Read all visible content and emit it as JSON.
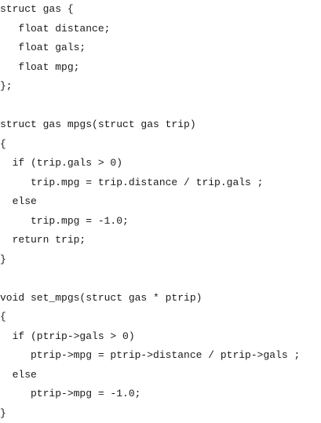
{
  "code_lines": [
    "struct gas {",
    "   float distance;",
    "   float gals;",
    "   float mpg;",
    "};",
    "",
    "struct gas mpgs(struct gas trip)",
    "{",
    "  if (trip.gals > 0)",
    "     trip.mpg = trip.distance / trip.gals ;",
    "  else",
    "     trip.mpg = -1.0;",
    "  return trip;",
    "}",
    "",
    "void set_mpgs(struct gas * ptrip)",
    "{",
    "  if (ptrip->gals > 0)",
    "     ptrip->mpg = ptrip->distance / ptrip->gals ;",
    "  else",
    "     ptrip->mpg = -1.0;",
    "}"
  ]
}
